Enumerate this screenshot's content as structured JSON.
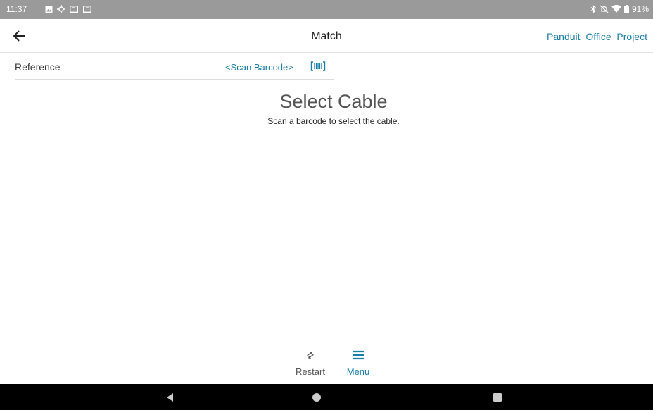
{
  "status_bar": {
    "time": "11:37",
    "battery": "91%",
    "left_icons": [
      "image-icon",
      "settings-icon",
      "tablet-icon",
      "tablet-icon"
    ],
    "right_icons": [
      "bluetooth-icon",
      "silent-icon",
      "wifi-icon",
      "battery-icon"
    ]
  },
  "app_bar": {
    "back_icon": "arrow-left-icon",
    "title": "Match",
    "project": "Panduit_Office_Project"
  },
  "reference": {
    "label": "Reference",
    "scan_link": "<Scan Barcode>",
    "icon": "barcode-icon"
  },
  "main": {
    "title": "Select Cable",
    "subtitle": "Scan a barcode to select the cable."
  },
  "actions": {
    "restart_label": "Restart",
    "menu_label": "Menu"
  },
  "nav": {
    "back": "triangle-back-icon",
    "home": "circle-home-icon",
    "recents": "square-recents-icon"
  },
  "colors": {
    "accent": "#1a7fa5",
    "status_bar": "#9a9a9a",
    "nav_bar": "#000000"
  }
}
